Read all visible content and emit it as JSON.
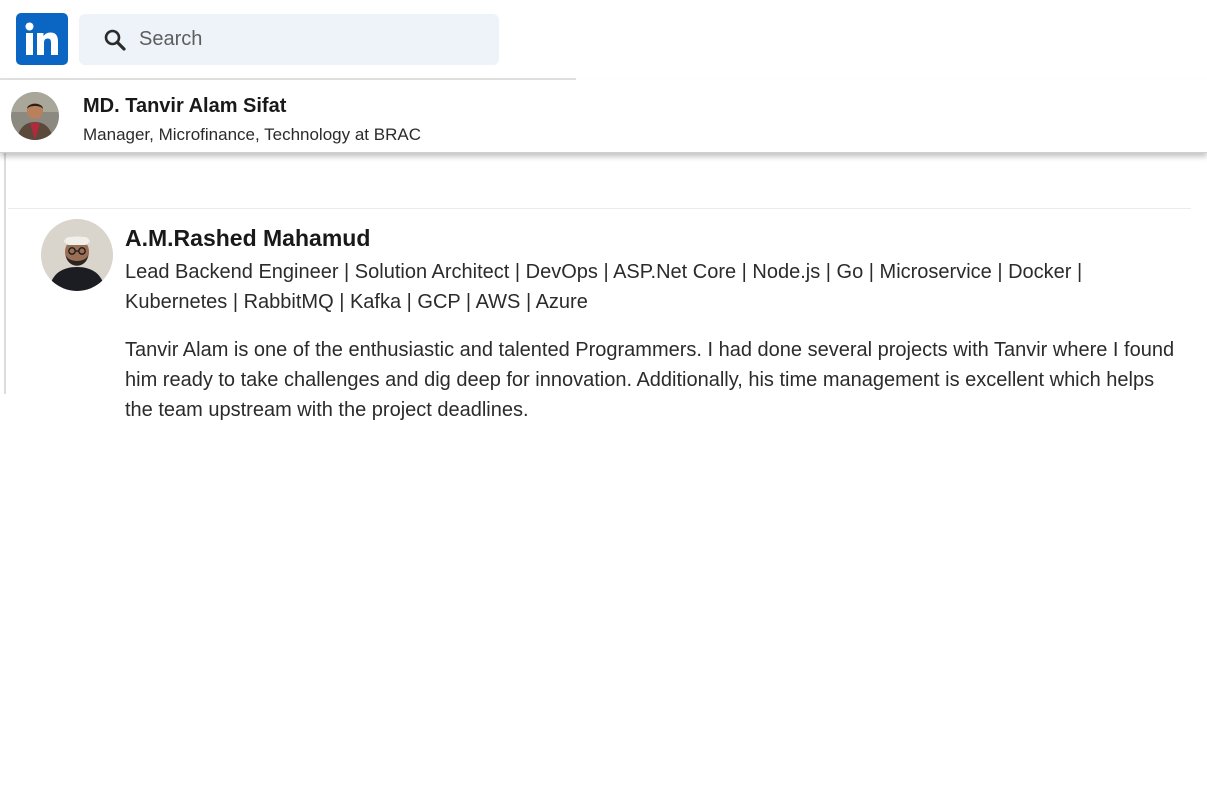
{
  "header": {
    "logo_text": "in",
    "logo_color": "#0a66c2",
    "search": {
      "icon": "search-icon",
      "placeholder": "Search"
    }
  },
  "profile": {
    "name": "MD. Tanvir Alam Sifat",
    "headline": "Manager, Microfinance, Technology at BRAC"
  },
  "recommendation": {
    "recommender_name": "A.M.Rashed Mahamud",
    "recommender_headline": "Lead Backend Engineer | Solution Architect | DevOps | ASP.Net Core | Node.js | Go | Microservice | Docker | Kubernetes | RabbitMQ | Kafka | GCP | AWS | Azure",
    "text": "Tanvir Alam is one of the enthusiastic and talented Programmers. I had done several projects with Tanvir where I found him ready to take challenges and dig deep for innovation. Additionally, his time management is excellent which helps the team upstream with the project deadlines."
  }
}
